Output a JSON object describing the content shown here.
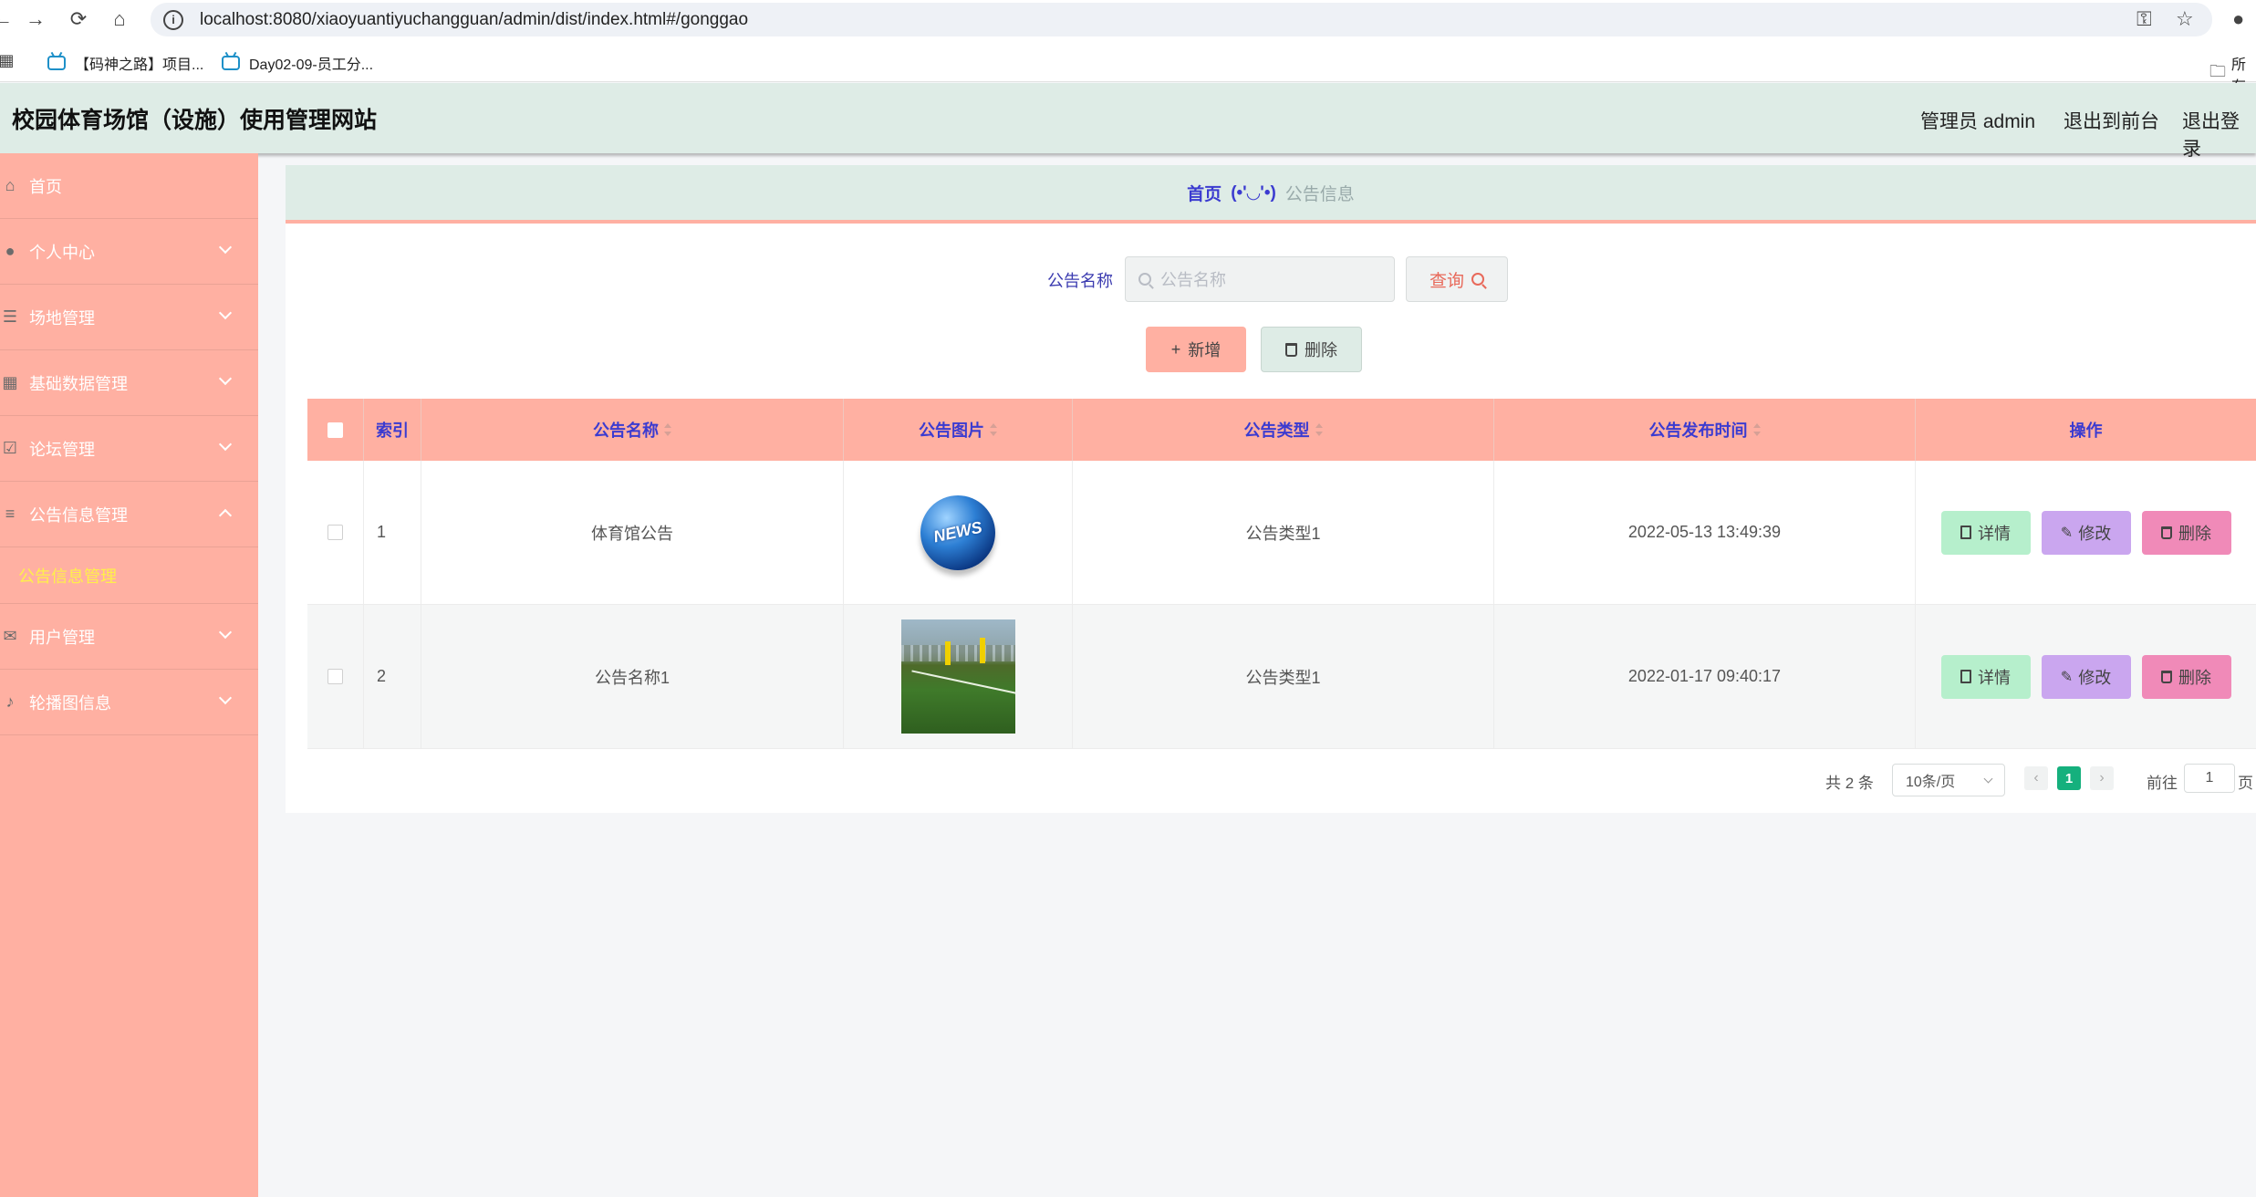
{
  "browser": {
    "url": "localhost:8080/xiaoyuantiyuchangguan/admin/dist/index.html#/gonggao",
    "bookmarks": [
      "【码神之路】项目...",
      "Day02-09-员工分..."
    ],
    "bookmark_right": "所有"
  },
  "header": {
    "title": "校园体育场馆（设施）使用管理网站",
    "user": "管理员 admin",
    "to_front": "退出到前台",
    "logout": "退出登录"
  },
  "sidebar": {
    "items": [
      {
        "label": "首页",
        "icon": "home-icon"
      },
      {
        "label": "个人中心",
        "icon": "user-icon"
      },
      {
        "label": "场地管理",
        "icon": "list-icon"
      },
      {
        "label": "基础数据管理",
        "icon": "grid-icon"
      },
      {
        "label": "论坛管理",
        "icon": "check-icon"
      },
      {
        "label": "公告信息管理",
        "icon": "sliders-icon"
      },
      {
        "label": "用户管理",
        "icon": "mail-icon"
      },
      {
        "label": "轮播图信息",
        "icon": "mic-icon"
      }
    ],
    "sub_active": "公告信息管理"
  },
  "breadcrumb": {
    "home": "首页",
    "separator": "(•'◡'•)",
    "current": "公告信息"
  },
  "search": {
    "label": "公告名称",
    "placeholder": "公告名称",
    "button": "查询"
  },
  "actions": {
    "add": "新增",
    "delete": "删除"
  },
  "table": {
    "columns": [
      "索引",
      "公告名称",
      "公告图片",
      "公告类型",
      "公告发布时间",
      "操作"
    ],
    "rows": [
      {
        "index": "1",
        "name": "体育馆公告",
        "image": "NEWS",
        "type": "公告类型1",
        "time": "2022-05-13 13:49:39"
      },
      {
        "index": "2",
        "name": "公告名称1",
        "image": "football-field-photo",
        "type": "公告类型1",
        "time": "2022-01-17 09:40:17"
      }
    ],
    "ops": {
      "detail": "详情",
      "edit": "修改",
      "delete": "删除"
    }
  },
  "pagination": {
    "total": "共 2 条",
    "page_size": "10条/页",
    "current_page": "1",
    "goto_label": "前往",
    "goto_value": "1",
    "page_suffix": "页"
  },
  "colors": {
    "accent_salmon": "#ffb0a2",
    "header_green": "#deece6",
    "title_blue": "#3b3bd0",
    "detail_green": "#b6efcc",
    "edit_purple": "#caa6ef",
    "delete_pink": "#f08ab8",
    "page_active": "#15b07d"
  }
}
